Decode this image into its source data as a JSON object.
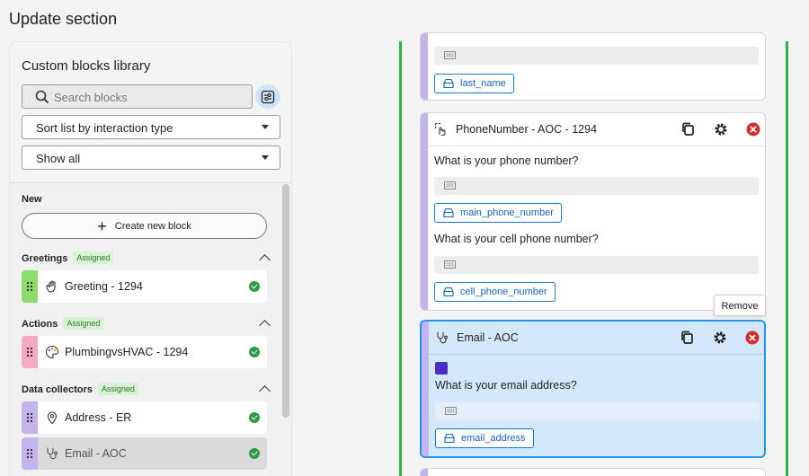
{
  "page": {
    "title": "Update section"
  },
  "library": {
    "title": "Custom blocks library",
    "search_placeholder": "Search blocks",
    "sort_select": "Sort list by interaction type",
    "show_select": "Show all",
    "new_label": "New",
    "create_button": "Create new block",
    "sections": [
      {
        "label": "Greetings",
        "badge": "Assigned",
        "items": [
          {
            "name": "Greeting - 1294",
            "color": "#8ddb6a",
            "icon": "hand-icon"
          }
        ]
      },
      {
        "label": "Actions",
        "badge": "Assigned",
        "items": [
          {
            "name": "PlumbingvsHVAC - 1294",
            "color": "#f7a8c4",
            "icon": "action-icon"
          }
        ]
      },
      {
        "label": "Data collectors",
        "badge": "Assigned",
        "items": [
          {
            "name": "Address - ER",
            "color": "#c3b4ee",
            "icon": "location-pin-icon"
          },
          {
            "name": "Email - AOC",
            "color": "#c3b4ee",
            "icon": "stethoscope-icon"
          }
        ]
      }
    ]
  },
  "canvas": {
    "cards": [
      {
        "var": "last_name"
      },
      {
        "title": "PhoneNumber - AOC - 1294",
        "icon": "tap-icon",
        "questions": [
          {
            "text": "What is your phone number?",
            "var": "main_phone_number"
          },
          {
            "text": "What is your cell phone number?",
            "var": "cell_phone_number"
          }
        ]
      },
      {
        "title": "Email - AOC",
        "icon": "stethoscope-icon",
        "questions": [
          {
            "text": "What is your email address?",
            "var": "email_address"
          }
        ]
      }
    ],
    "tooltip": "Remove"
  },
  "colors": {
    "accent": "#2196f3",
    "lane": "#27b83a",
    "remove": "#d32f2f",
    "assigned_badge": "#d9f2d6"
  }
}
